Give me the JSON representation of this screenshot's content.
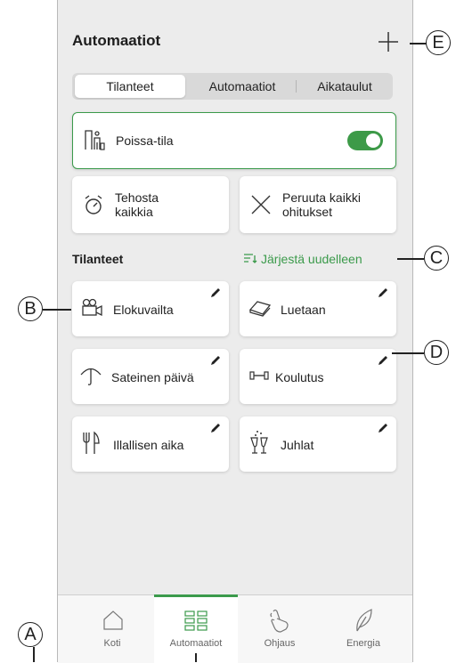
{
  "header": {
    "title": "Automaatiot"
  },
  "tabs": [
    {
      "label": "Tilanteet",
      "active": true
    },
    {
      "label": "Automaatiot",
      "active": false
    },
    {
      "label": "Aikataulut",
      "active": false
    }
  ],
  "away_mode": {
    "label": "Poissa-tila",
    "enabled": true
  },
  "actions": {
    "boost": "Tehosta\nkaikkia",
    "cancel": "Peruuta kaikki\nohitukset"
  },
  "scenes_section": {
    "title": "Tilanteet",
    "reorder": "Järjestä uudelleen"
  },
  "scenes": [
    {
      "label": "Elokuvailta",
      "icon": "movie-camera-icon"
    },
    {
      "label": "Luetaan",
      "icon": "book-icon"
    },
    {
      "label": "Sateinen päivä",
      "icon": "umbrella-icon"
    },
    {
      "label": "Koulutus",
      "icon": "dumbbell-icon"
    },
    {
      "label": "Illallisen aika",
      "icon": "cutlery-icon"
    },
    {
      "label": "Juhlat",
      "icon": "champagne-icon"
    }
  ],
  "bottom_nav": [
    {
      "label": "Koti",
      "icon": "home-icon",
      "active": false
    },
    {
      "label": "Automaatiot",
      "icon": "grid-icon",
      "active": true
    },
    {
      "label": "Ohjaus",
      "icon": "hand-icon",
      "active": false
    },
    {
      "label": "Energia",
      "icon": "leaf-icon",
      "active": false
    }
  ],
  "callouts": {
    "a": "A",
    "b": "B",
    "c": "C",
    "d": "D",
    "e": "E"
  },
  "colors": {
    "accent": "#3b9a4b",
    "background": "#ececec",
    "card": "#ffffff"
  }
}
